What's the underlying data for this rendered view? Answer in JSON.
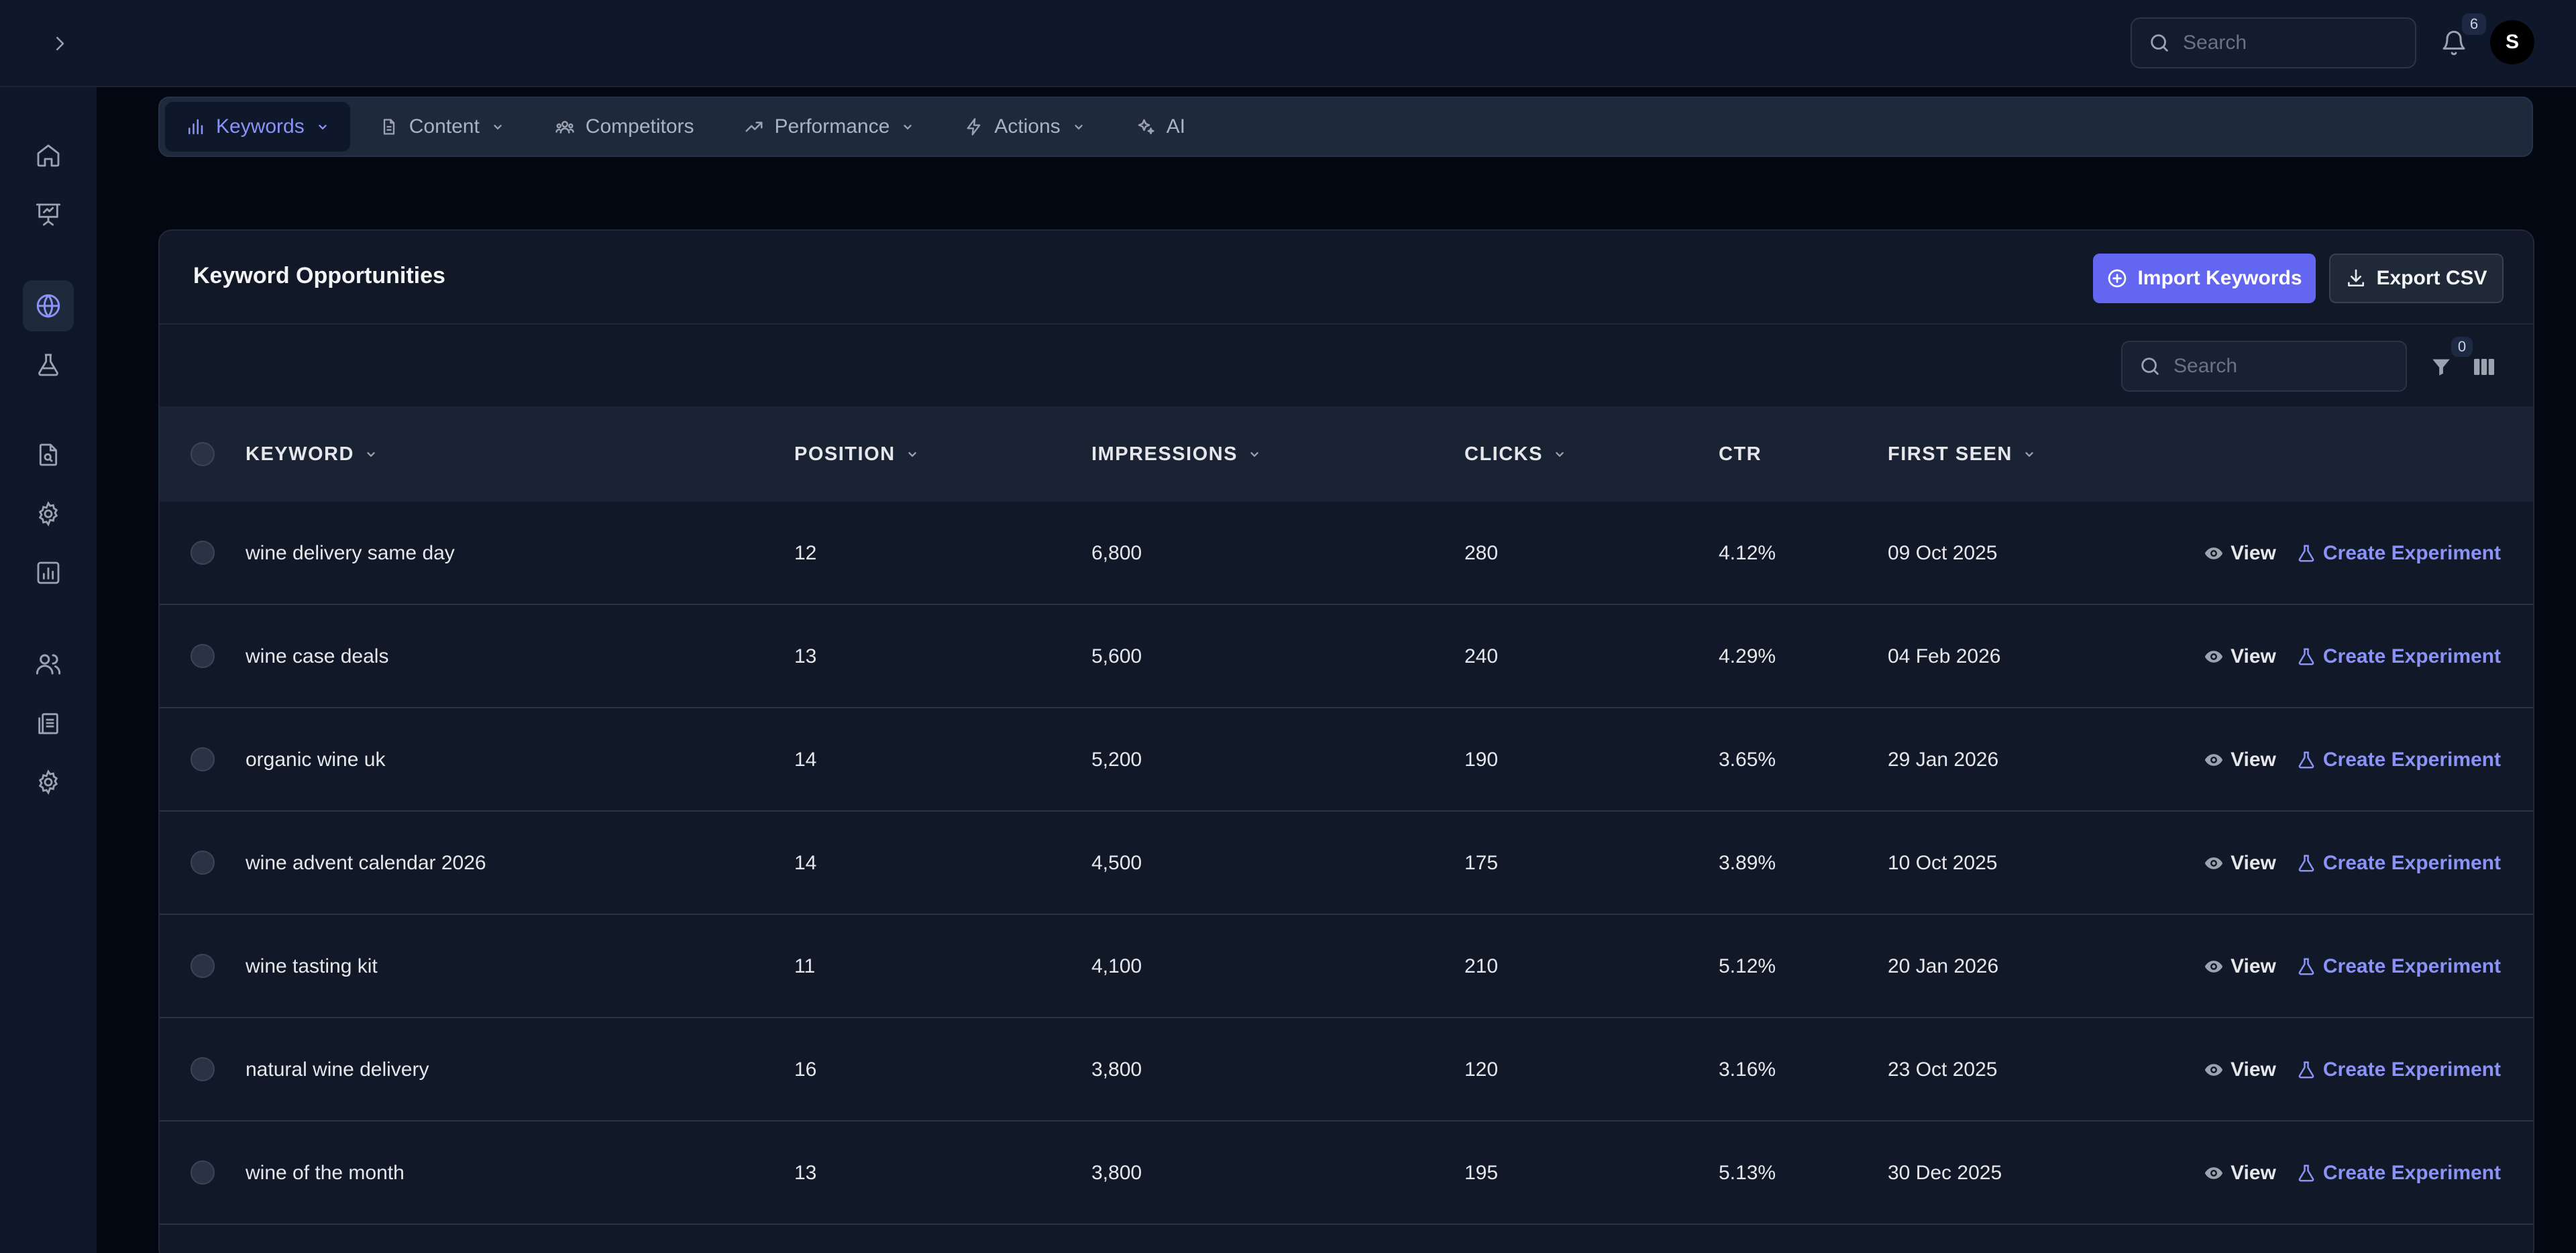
{
  "topbar": {
    "search_placeholder": "Search",
    "notification_count": "6",
    "avatar_initial": "S"
  },
  "nav": {
    "tabs": [
      {
        "label": "Keywords",
        "icon": "bar-chart-icon",
        "dropdown": true,
        "active": true
      },
      {
        "label": "Content",
        "icon": "file-icon",
        "dropdown": true,
        "active": false
      },
      {
        "label": "Competitors",
        "icon": "users-group-icon",
        "dropdown": false,
        "active": false
      },
      {
        "label": "Performance",
        "icon": "trend-up-icon",
        "dropdown": true,
        "active": false
      },
      {
        "label": "Actions",
        "icon": "lightning-icon",
        "dropdown": true,
        "active": false
      },
      {
        "label": "AI",
        "icon": "sparkles-icon",
        "dropdown": false,
        "active": false
      }
    ]
  },
  "card": {
    "title": "Keyword Opportunities",
    "import_label": "Import Keywords",
    "export_label": "Export CSV",
    "search_placeholder": "Search",
    "filter_count": "0"
  },
  "table": {
    "columns": [
      "KEYWORD",
      "POSITION",
      "IMPRESSIONS",
      "CLICKS",
      "CTR",
      "FIRST SEEN"
    ],
    "view_label": "View",
    "experiment_label": "Create Experiment",
    "rows": [
      {
        "keyword": "wine delivery same day",
        "position": "12",
        "impressions": "6,800",
        "clicks": "280",
        "ctr": "4.12%",
        "first_seen": "09 Oct 2025"
      },
      {
        "keyword": "wine case deals",
        "position": "13",
        "impressions": "5,600",
        "clicks": "240",
        "ctr": "4.29%",
        "first_seen": "04 Feb 2026"
      },
      {
        "keyword": "organic wine uk",
        "position": "14",
        "impressions": "5,200",
        "clicks": "190",
        "ctr": "3.65%",
        "first_seen": "29 Jan 2026"
      },
      {
        "keyword": "wine advent calendar 2026",
        "position": "14",
        "impressions": "4,500",
        "clicks": "175",
        "ctr": "3.89%",
        "first_seen": "10 Oct 2025"
      },
      {
        "keyword": "wine tasting kit",
        "position": "11",
        "impressions": "4,100",
        "clicks": "210",
        "ctr": "5.12%",
        "first_seen": "20 Jan 2026"
      },
      {
        "keyword": "natural wine delivery",
        "position": "16",
        "impressions": "3,800",
        "clicks": "120",
        "ctr": "3.16%",
        "first_seen": "23 Oct 2025"
      },
      {
        "keyword": "wine of the month",
        "position": "13",
        "impressions": "3,800",
        "clicks": "195",
        "ctr": "5.13%",
        "first_seen": "30 Dec 2025"
      }
    ]
  },
  "colors": {
    "accent": "#6366f1",
    "accent_text": "#8b93f8",
    "background": "#030712",
    "surface": "#111827"
  }
}
